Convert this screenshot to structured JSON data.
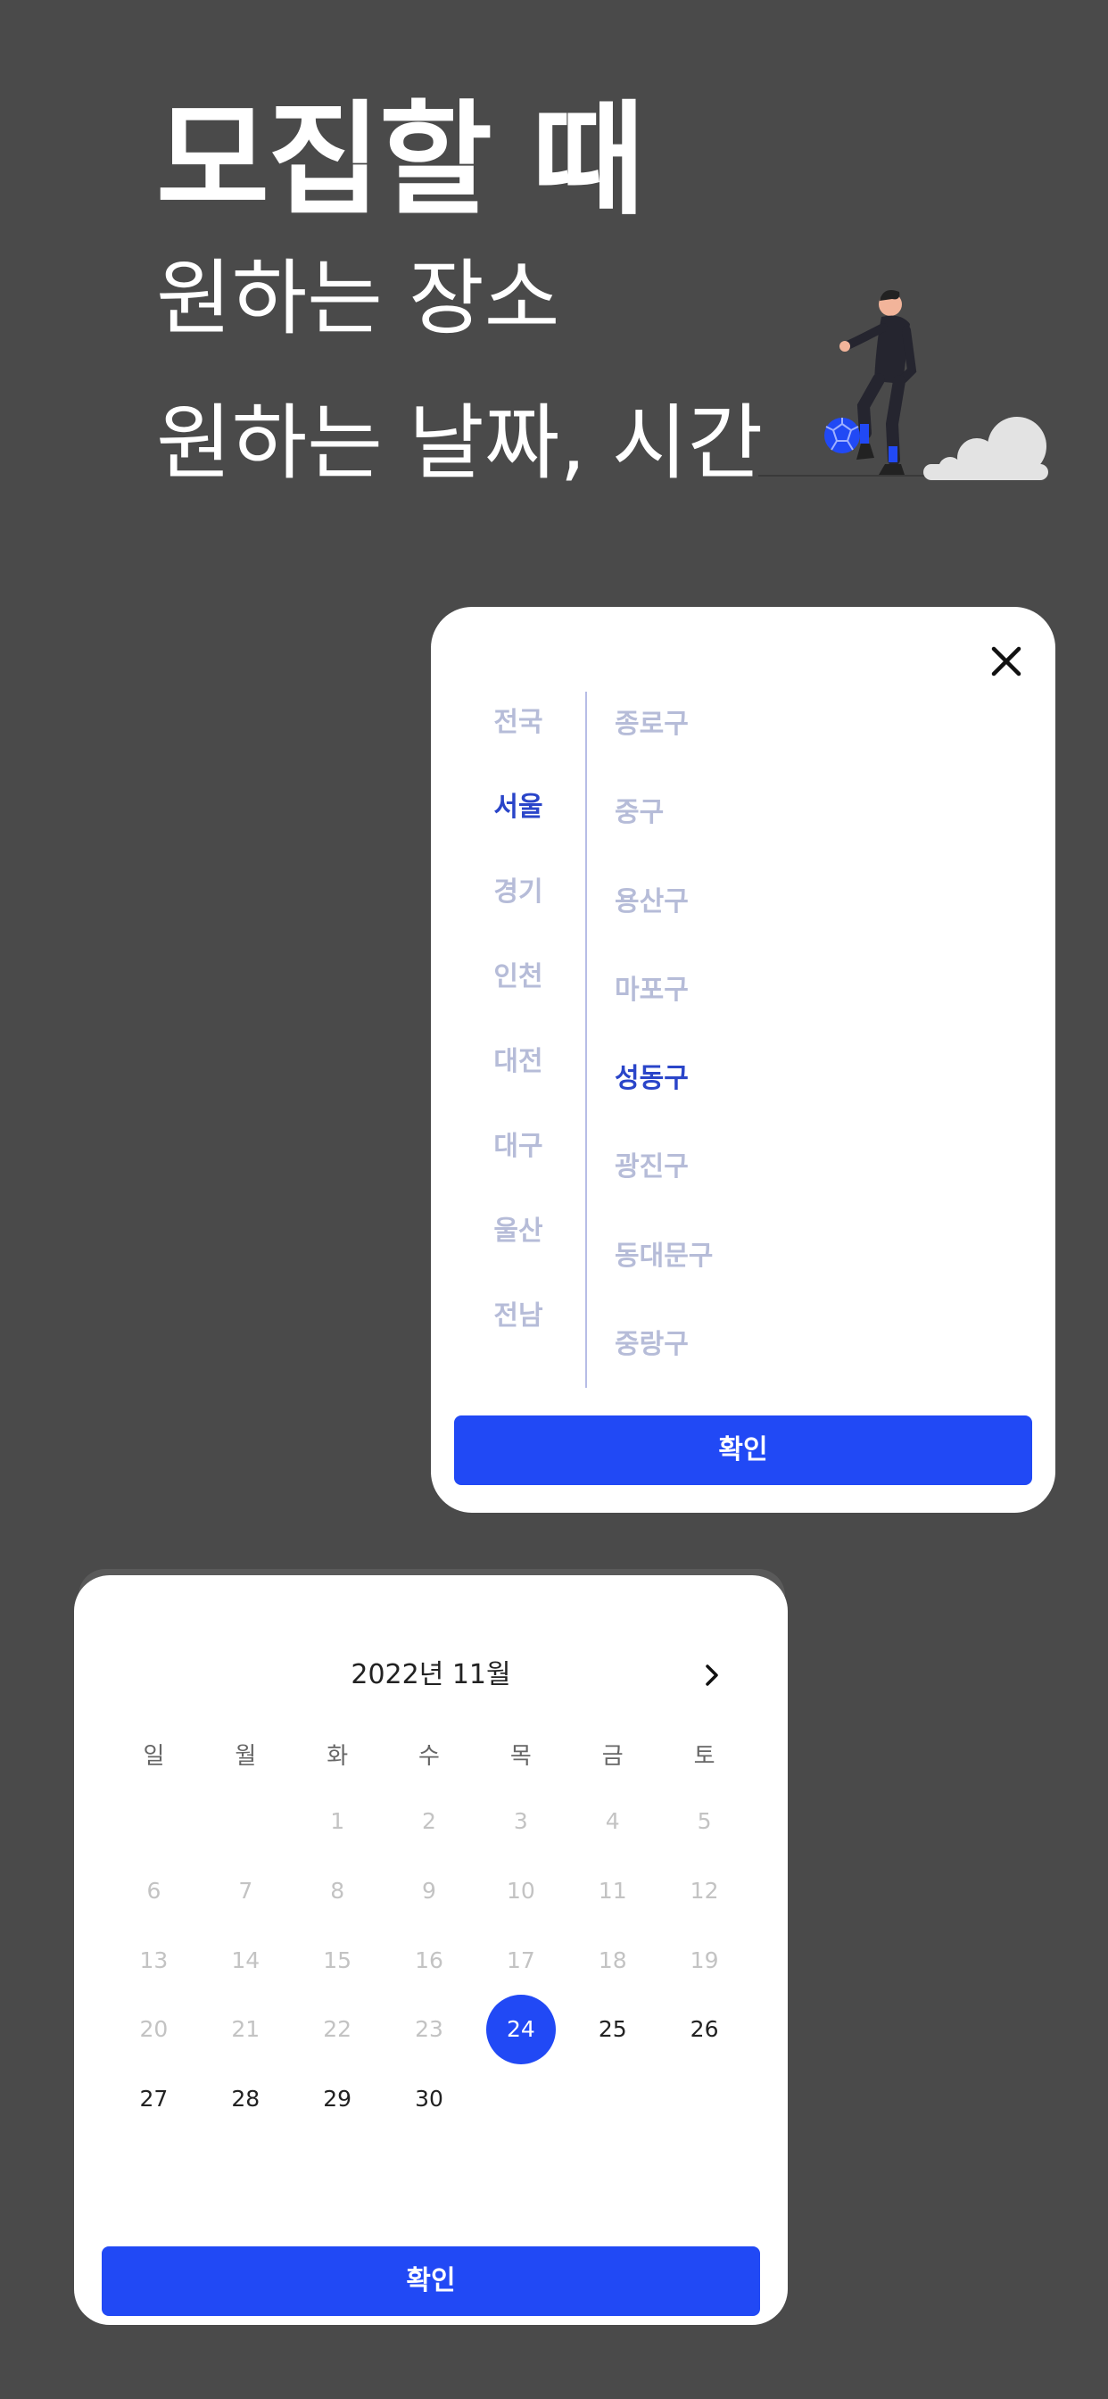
{
  "headline": {
    "line1": "모집할 때",
    "line2": "원하는 장소",
    "line3": "원하는 날짜, 시간"
  },
  "location_modal": {
    "regions": [
      "전국",
      "서울",
      "경기",
      "인천",
      "대전",
      "대구",
      "울산",
      "전남"
    ],
    "selected_region": "서울",
    "districts": [
      "종로구",
      "중구",
      "용산구",
      "마포구",
      "성동구",
      "광진구",
      "동대문구",
      "중랑구"
    ],
    "selected_district": "성동구",
    "confirm_label": "확인"
  },
  "calendar_modal": {
    "month_title": "2022년 11월",
    "weekdays": [
      "일",
      "월",
      "화",
      "수",
      "목",
      "금",
      "토"
    ],
    "weeks": [
      [
        "",
        "",
        "1",
        "2",
        "3",
        "4",
        "5"
      ],
      [
        "6",
        "7",
        "8",
        "9",
        "10",
        "11",
        "12"
      ],
      [
        "13",
        "14",
        "15",
        "16",
        "17",
        "18",
        "19"
      ],
      [
        "20",
        "21",
        "22",
        "23",
        "24",
        "25",
        "26"
      ],
      [
        "27",
        "28",
        "29",
        "30",
        "",
        "",
        ""
      ]
    ],
    "selected_day": "24",
    "first_available_day": 24,
    "confirm_label": "확인"
  },
  "colors": {
    "background": "#4a4a4a",
    "accent": "#2149f5",
    "active_text": "#2a45c9",
    "inactive_text": "#b6bcd8"
  }
}
